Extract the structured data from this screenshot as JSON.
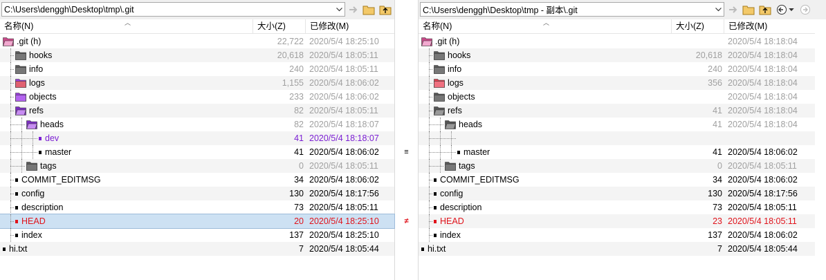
{
  "left": {
    "path": "C:\\Users\\denggh\\Desktop\\tmp\\.git",
    "columns": {
      "name": "名称(N)",
      "size": "大小(Z)",
      "modified": "已修改(M)"
    },
    "rows": [
      {
        "name": ".git (h)",
        "size": "22,722",
        "date": "2020/5/4 18:25:10",
        "icon": "folder-open-pink-icon",
        "color": "gray",
        "indent": 0
      },
      {
        "name": "hooks",
        "size": "20,618",
        "date": "2020/5/4 18:05:11",
        "icon": "folder-gray-icon",
        "color": "gray",
        "indent": 1
      },
      {
        "name": "info",
        "size": "240",
        "date": "2020/5/4 18:05:11",
        "icon": "folder-gray-icon",
        "color": "gray",
        "indent": 1
      },
      {
        "name": "logs",
        "size": "1,155",
        "date": "2020/5/4 18:06:02",
        "icon": "folder-purple-red-icon",
        "color": "gray",
        "indent": 1
      },
      {
        "name": "objects",
        "size": "233",
        "date": "2020/5/4 18:06:02",
        "icon": "folder-purple-icon",
        "color": "gray",
        "indent": 1
      },
      {
        "name": "refs",
        "size": "82",
        "date": "2020/5/4 18:05:11",
        "icon": "folder-open-purple-icon",
        "color": "gray",
        "indent": 1
      },
      {
        "name": "heads",
        "size": "82",
        "date": "2020/5/4 18:18:07",
        "icon": "folder-open-purple-icon",
        "color": "gray",
        "indent": 2
      },
      {
        "name": "dev",
        "size": "41",
        "date": "2020/5/4 18:18:07",
        "icon": "file-purple-icon",
        "color": "purple",
        "indent": 3
      },
      {
        "name": "master",
        "size": "41",
        "date": "2020/5/4 18:06:02",
        "icon": "file-icon",
        "color": "black",
        "indent": 3
      },
      {
        "name": "tags",
        "size": "0",
        "date": "2020/5/4 18:05:11",
        "icon": "folder-gray-icon",
        "color": "gray",
        "indent": 2
      },
      {
        "name": "COMMIT_EDITMSG",
        "size": "34",
        "date": "2020/5/4 18:06:02",
        "icon": "file-icon",
        "color": "black",
        "indent": 1
      },
      {
        "name": "config",
        "size": "130",
        "date": "2020/5/4 18:17:56",
        "icon": "file-icon",
        "color": "black",
        "indent": 1
      },
      {
        "name": "description",
        "size": "73",
        "date": "2020/5/4 18:05:11",
        "icon": "file-icon",
        "color": "black",
        "indent": 1
      },
      {
        "name": "HEAD",
        "size": "20",
        "date": "2020/5/4 18:25:10",
        "icon": "file-red-icon",
        "color": "red",
        "indent": 1,
        "selected": true
      },
      {
        "name": "index",
        "size": "137",
        "date": "2020/5/4 18:25:10",
        "icon": "file-icon",
        "color": "black",
        "indent": 1
      },
      {
        "name": "hi.txt",
        "size": "7",
        "date": "2020/5/4 18:05:44",
        "icon": "file-icon",
        "color": "black",
        "indent": 0
      }
    ]
  },
  "right": {
    "path": "C:\\Users\\denggh\\Desktop\\tmp - 副本\\.git",
    "columns": {
      "name": "名称(N)",
      "size": "大小(Z)",
      "modified": "已修改(M)"
    },
    "rows": [
      {
        "name": ".git (h)",
        "size": "",
        "date": "2020/5/4 18:18:04",
        "icon": "folder-open-pink-icon",
        "color": "gray",
        "indent": 0
      },
      {
        "name": "hooks",
        "size": "20,618",
        "date": "2020/5/4 18:18:04",
        "icon": "folder-gray-icon",
        "color": "gray",
        "indent": 1
      },
      {
        "name": "info",
        "size": "240",
        "date": "2020/5/4 18:18:04",
        "icon": "folder-gray-icon",
        "color": "gray",
        "indent": 1
      },
      {
        "name": "logs",
        "size": "356",
        "date": "2020/5/4 18:18:04",
        "icon": "folder-red-icon",
        "color": "gray",
        "indent": 1
      },
      {
        "name": "objects",
        "size": "",
        "date": "2020/5/4 18:18:04",
        "icon": "folder-gray-icon",
        "color": "gray",
        "indent": 1
      },
      {
        "name": "refs",
        "size": "41",
        "date": "2020/5/4 18:18:04",
        "icon": "folder-open-gray-icon",
        "color": "gray",
        "indent": 1
      },
      {
        "name": "heads",
        "size": "41",
        "date": "2020/5/4 18:18:04",
        "icon": "folder-open-gray-icon",
        "color": "gray",
        "indent": 2
      },
      {
        "name": "",
        "size": "",
        "date": "",
        "icon": "",
        "color": "black",
        "indent": 3,
        "empty": true
      },
      {
        "name": "master",
        "size": "41",
        "date": "2020/5/4 18:06:02",
        "icon": "file-icon",
        "color": "black",
        "indent": 3
      },
      {
        "name": "tags",
        "size": "0",
        "date": "2020/5/4 18:05:11",
        "icon": "folder-gray-icon",
        "color": "gray",
        "indent": 2
      },
      {
        "name": "COMMIT_EDITMSG",
        "size": "34",
        "date": "2020/5/4 18:06:02",
        "icon": "file-icon",
        "color": "black",
        "indent": 1
      },
      {
        "name": "config",
        "size": "130",
        "date": "2020/5/4 18:17:56",
        "icon": "file-icon",
        "color": "black",
        "indent": 1
      },
      {
        "name": "description",
        "size": "73",
        "date": "2020/5/4 18:05:11",
        "icon": "file-icon",
        "color": "black",
        "indent": 1
      },
      {
        "name": "HEAD",
        "size": "23",
        "date": "2020/5/4 18:05:11",
        "icon": "file-red-icon",
        "color": "red",
        "indent": 1
      },
      {
        "name": "index",
        "size": "137",
        "date": "2020/5/4 18:06:02",
        "icon": "file-icon",
        "color": "black",
        "indent": 1
      },
      {
        "name": "hi.txt",
        "size": "7",
        "date": "2020/5/4 18:05:44",
        "icon": "file-icon",
        "color": "black",
        "indent": 0
      }
    ]
  },
  "middle_marks": [
    {
      "row": 8,
      "symbol": "≡",
      "color": "#000000",
      "icon": "equal-icon"
    },
    {
      "row": 13,
      "symbol": "≠",
      "color": "#e0131b",
      "icon": "not-equal-icon"
    }
  ],
  "colors": {
    "selected_row": "#cde1f3",
    "gray_text": "#a0a0a0",
    "diff_red": "#e0131b",
    "orphan_purple": "#7b1fd3"
  }
}
